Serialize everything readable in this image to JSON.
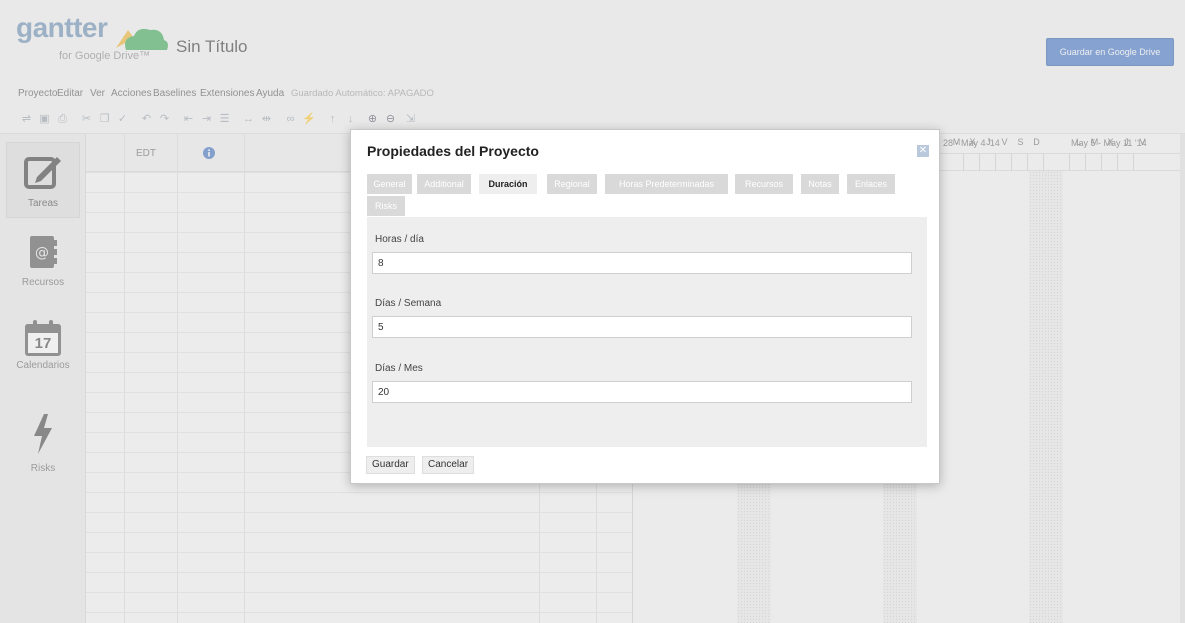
{
  "app": {
    "logo_text": "gantter",
    "logo_sub": "for Google Drive™",
    "doc_title": "Sin Título",
    "save_drive_label": "Guardar en Google Drive"
  },
  "menu": {
    "items": [
      "Proyecto",
      "Editar",
      "Ver",
      "Acciones",
      "Baselines",
      "Extensiones",
      "Ayuda"
    ],
    "autosave": "Guardado Automático: APAGADO"
  },
  "sidebar": {
    "items": [
      {
        "label": "Tareas",
        "icon": "edit-icon"
      },
      {
        "label": "Recursos",
        "icon": "address-book-icon"
      },
      {
        "label": "Calendarios",
        "icon": "calendar-icon",
        "calendar_day": "17"
      },
      {
        "label": "Risks",
        "icon": "lightning-icon"
      }
    ]
  },
  "grid": {
    "col_edt": "EDT"
  },
  "gantt": {
    "weeks": [
      "28 - May 4 '14",
      "May 5 - May 11 '14"
    ],
    "days_week1": [
      "M",
      "X",
      "J",
      "V",
      "S",
      "D"
    ],
    "days_week2": [
      "L",
      "M",
      "X",
      "J",
      "V"
    ]
  },
  "dialog": {
    "title": "Propiedades del Proyecto",
    "tabs": [
      "General",
      "Additional",
      "Duración",
      "Regional",
      "Horas Predeterminadas",
      "Recursos",
      "Notas",
      "Enlaces",
      "Risks"
    ],
    "active_tab": "Duración",
    "fields": {
      "hours_day": {
        "label": "Horas / día",
        "value": "8"
      },
      "days_week": {
        "label": "Días / Semana",
        "value": "5"
      },
      "days_month": {
        "label": "Días / Mes",
        "value": "20"
      }
    },
    "save_label": "Guardar",
    "cancel_label": "Cancelar"
  }
}
